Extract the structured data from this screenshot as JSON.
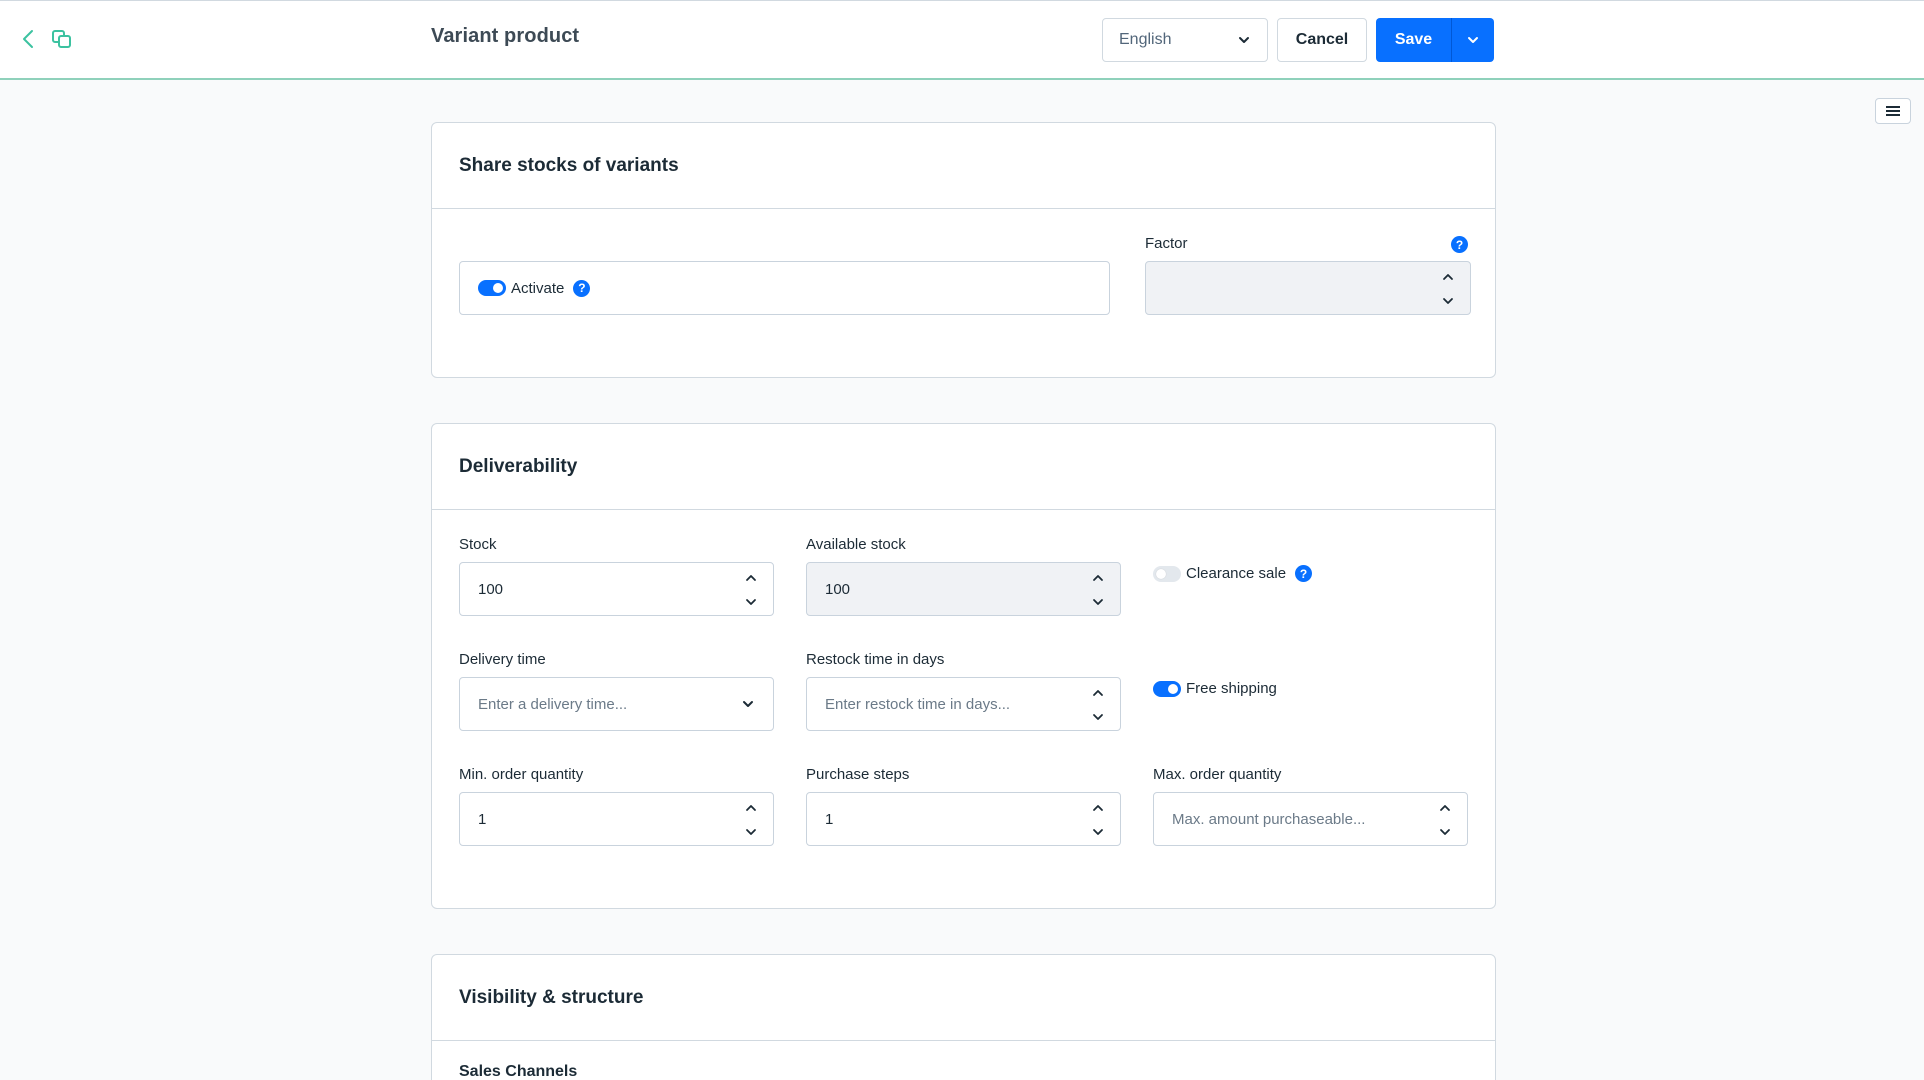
{
  "header": {
    "title": "Variant product",
    "language": "English",
    "cancel_label": "Cancel",
    "save_label": "Save"
  },
  "share_stocks": {
    "title": "Share stocks of variants",
    "activate_label": "Activate",
    "activate_on": true,
    "factor_label": "Factor",
    "factor_value": ""
  },
  "deliverability": {
    "title": "Deliverability",
    "stock_label": "Stock",
    "stock_value": "100",
    "available_stock_label": "Available stock",
    "available_stock_value": "100",
    "clearance_sale_label": "Clearance sale",
    "clearance_sale_on": false,
    "delivery_time_label": "Delivery time",
    "delivery_time_placeholder": "Enter a delivery time...",
    "restock_label": "Restock time in days",
    "restock_placeholder": "Enter restock time in days...",
    "free_shipping_label": "Free shipping",
    "free_shipping_on": true,
    "min_order_label": "Min. order quantity",
    "min_order_value": "1",
    "purchase_steps_label": "Purchase steps",
    "purchase_steps_value": "1",
    "max_order_label": "Max. order quantity",
    "max_order_placeholder": "Max. amount purchaseable..."
  },
  "visibility": {
    "title": "Visibility & structure",
    "sales_channels_label": "Sales Channels"
  },
  "colors": {
    "primary": "#0870ff",
    "header_accent": "#8fd1bb",
    "nav_icon": "#3cc2a0"
  }
}
